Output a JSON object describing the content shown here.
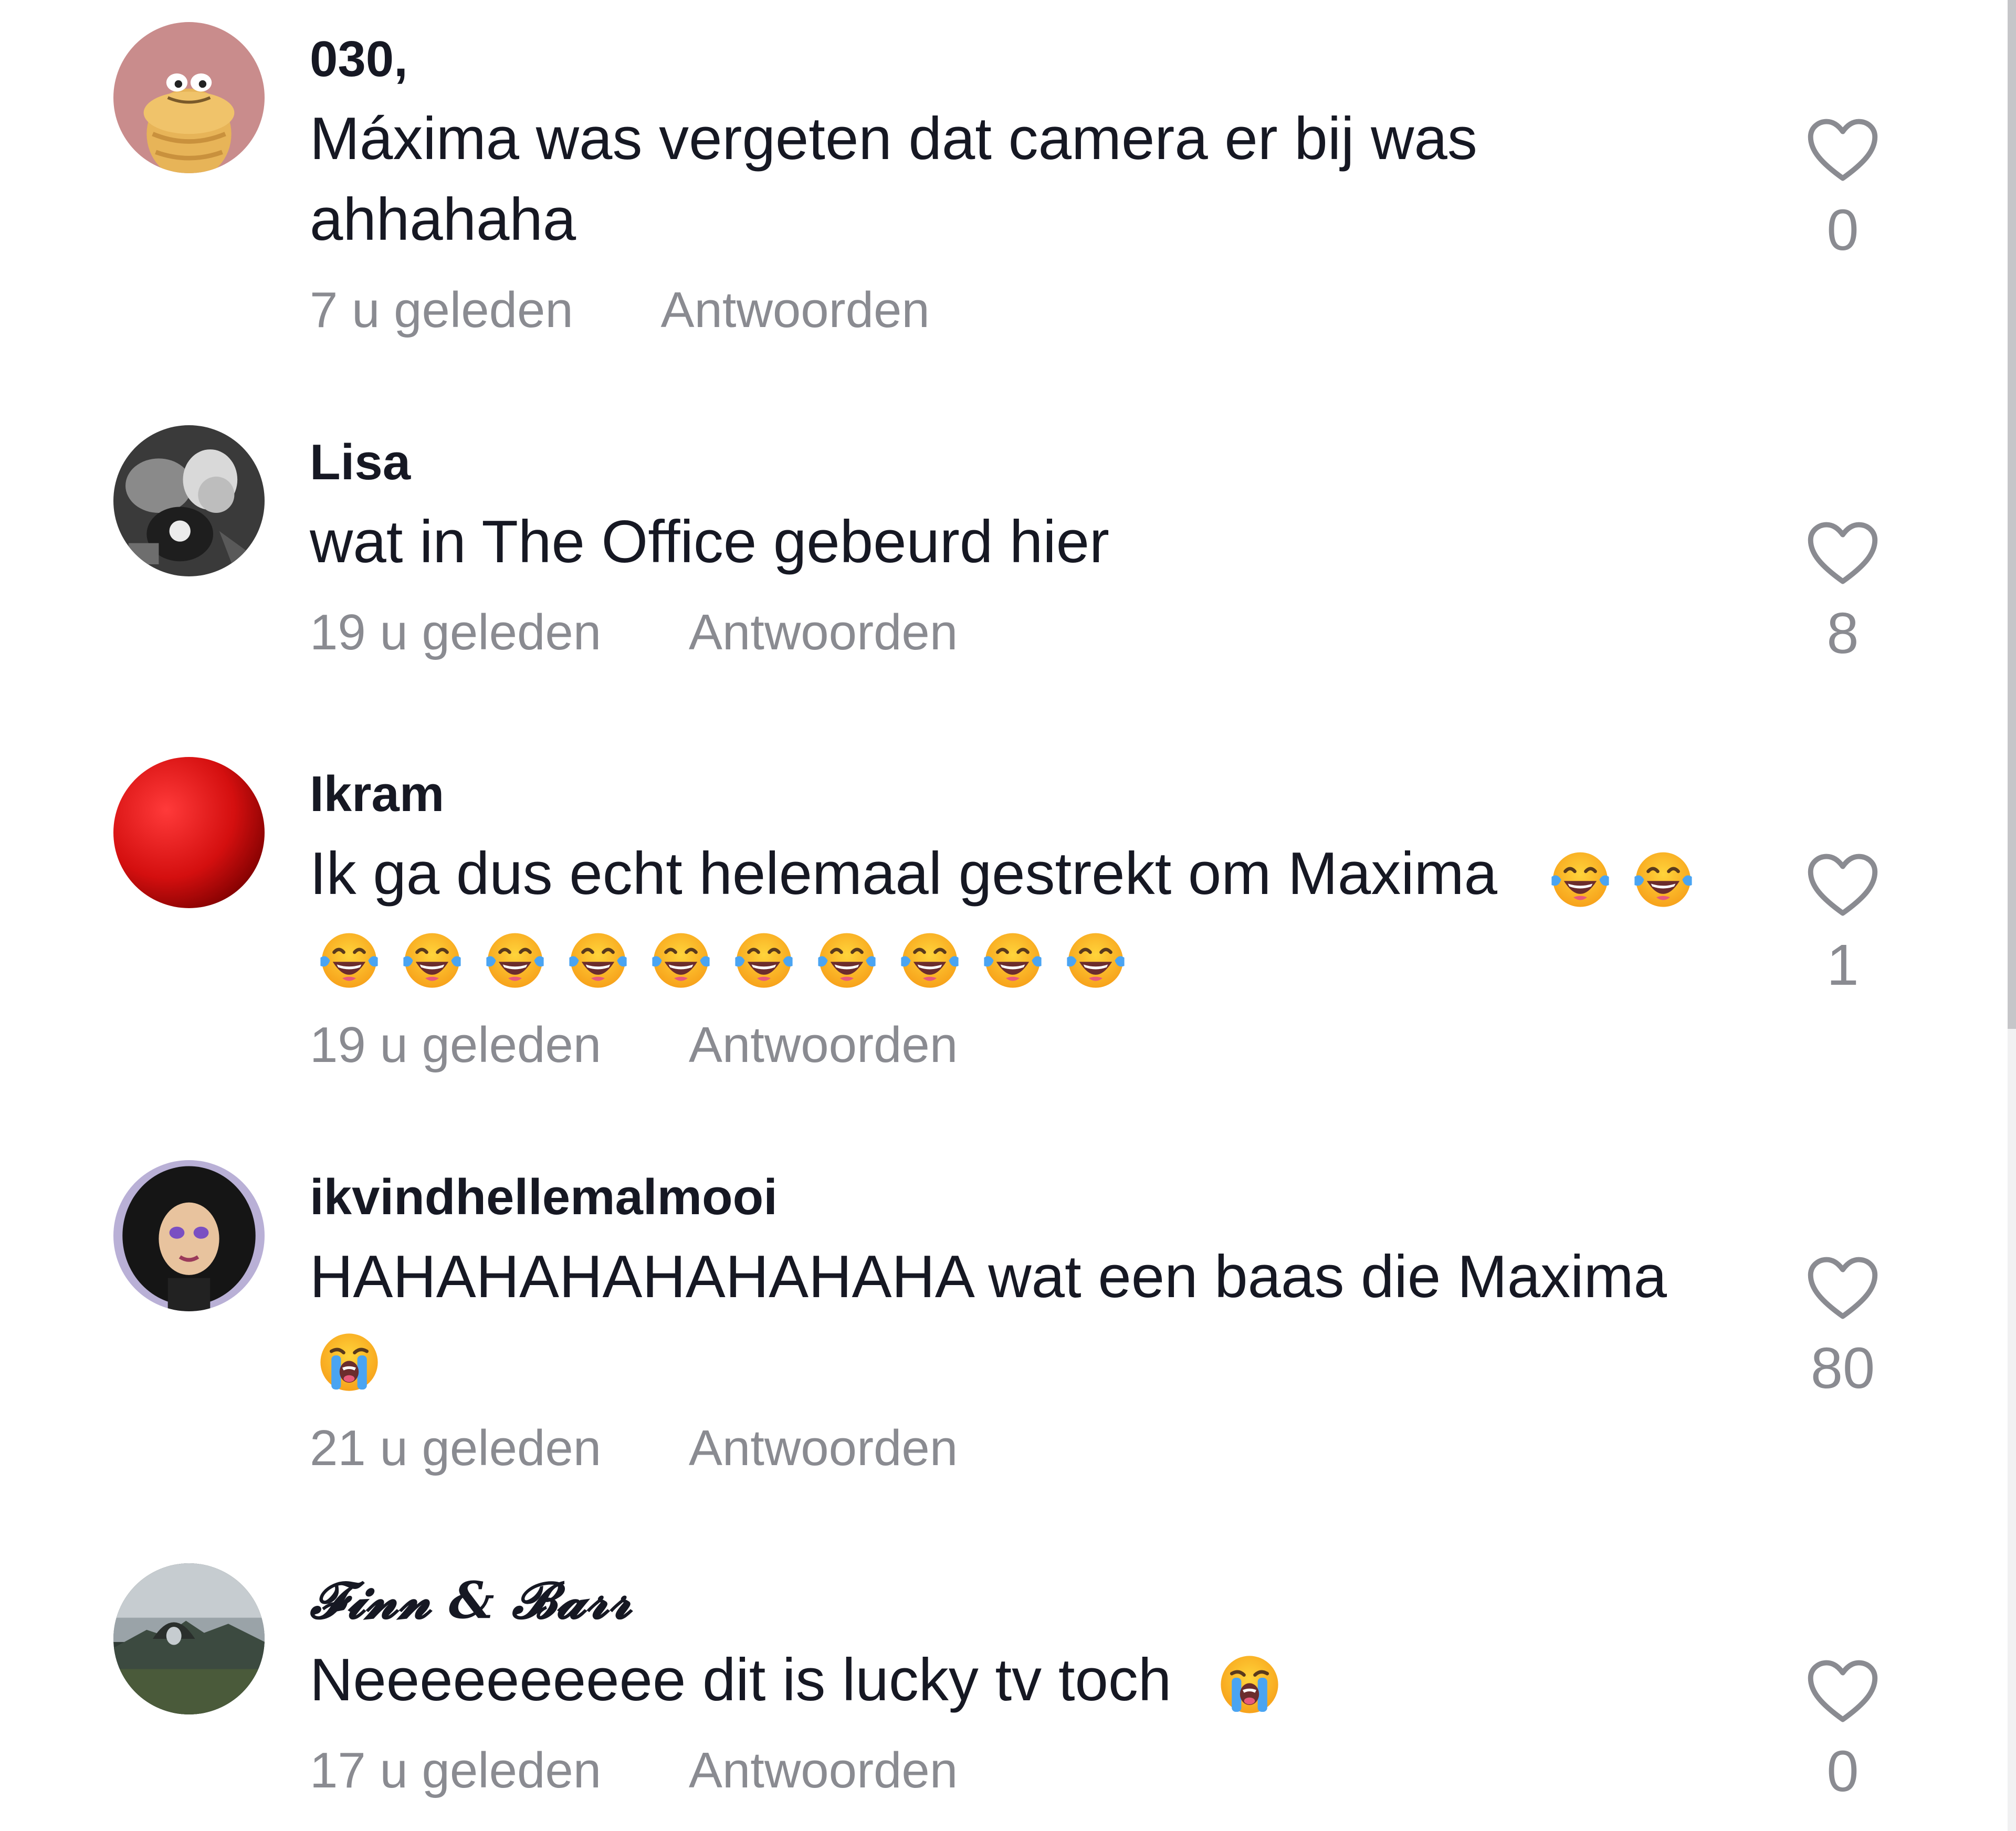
{
  "comments": [
    {
      "username": "030,",
      "text": "Máxima was vergeten dat camera er bij was ahhahaha",
      "time": "7 u geleden",
      "reply_label": "Antwoorden",
      "likes": "0"
    },
    {
      "username": "Lisa",
      "text": "wat in The Office gebeurd hier",
      "time": "19 u geleden",
      "reply_label": "Antwoorden",
      "likes": "8"
    },
    {
      "username": "Ikram",
      "text": "Ik ga dus echt helemaal gestrekt om Maxima",
      "time": "19 u geleden",
      "reply_label": "Antwoorden",
      "likes": "1",
      "emojis": [
        "face-with-tears-of-joy",
        "face-with-tears-of-joy",
        "face-with-tears-of-joy",
        "face-with-tears-of-joy",
        "face-with-tears-of-joy",
        "face-with-tears-of-joy",
        "face-with-tears-of-joy",
        "face-with-tears-of-joy",
        "face-with-tears-of-joy",
        "face-with-tears-of-joy",
        "face-with-tears-of-joy",
        "face-with-tears-of-joy"
      ]
    },
    {
      "username": "ikvindhellemalmooi",
      "text": "HAHAHAHAHAHAHAHA wat een baas die Maxima",
      "time": "21 u geleden",
      "reply_label": "Antwoorden",
      "likes": "80",
      "emojis": [
        "loudly-crying-face"
      ]
    },
    {
      "username": "𝓕𝓲𝓷𝓷 & 𝓑𝓪𝓻𝓻",
      "text": "Neeeeeeeeee dit is lucky tv toch",
      "time": "17 u geleden",
      "reply_label": "Antwoorden",
      "likes": "0",
      "emojis": [
        "loudly-crying-face"
      ]
    }
  ],
  "colors": {
    "text_primary": "#161823",
    "text_secondary": "#8a8b91",
    "background": "#ffffff"
  },
  "icons": {
    "like": "heart-outline-icon"
  }
}
